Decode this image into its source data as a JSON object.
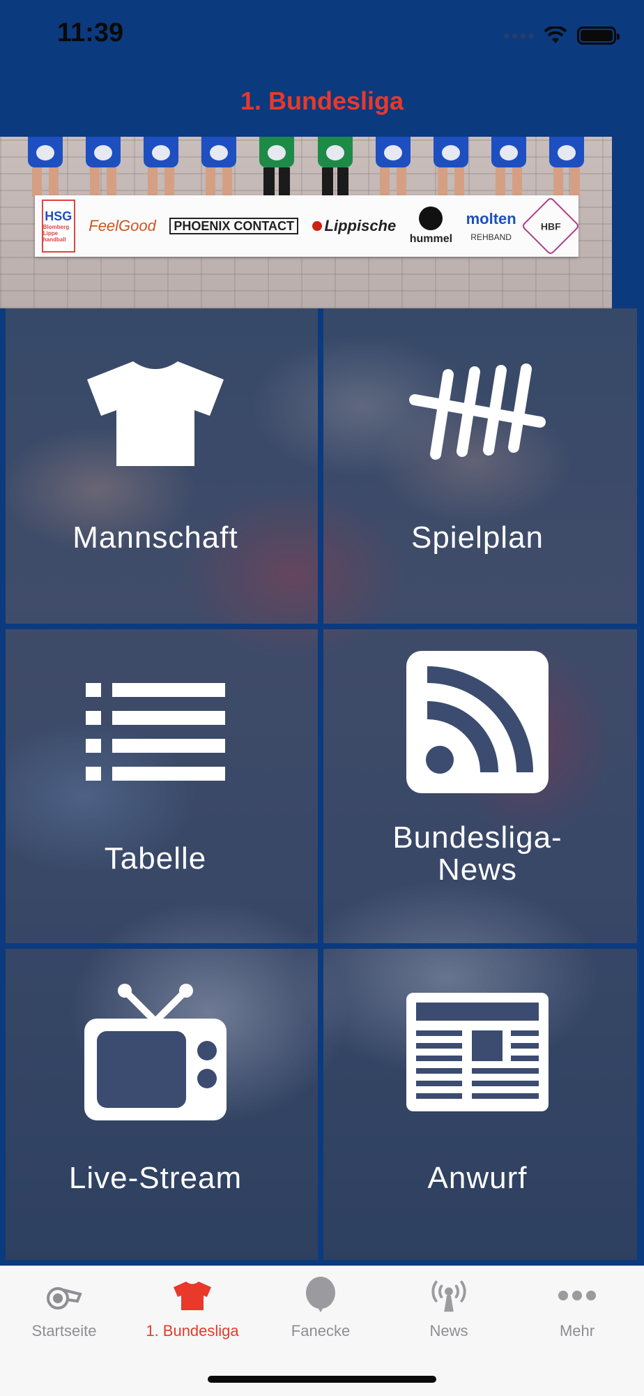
{
  "status_bar": {
    "time": "11:39"
  },
  "navbar": {
    "title": "1. Bundesliga"
  },
  "banner": {
    "sponsors": {
      "hsg": "HSG",
      "hsg_sub": "Blomberg Lippe handball",
      "feelgood": "FeelGood",
      "phoenix": "PHOENIX CONTACT",
      "lippische": "Lippische",
      "hummel": "hummel",
      "molten": "molten",
      "rehband": "REHBAND",
      "hbf": "HBF"
    }
  },
  "tiles": [
    {
      "label": "Mannschaft",
      "icon": "shirt-icon"
    },
    {
      "label": "Spielplan",
      "icon": "tally-icon"
    },
    {
      "label": "Tabelle",
      "icon": "list-icon"
    },
    {
      "label": "Bundesliga-News",
      "label_line1": "Bundesliga-",
      "label_line2": "News",
      "icon": "rss-icon"
    },
    {
      "label": "Live-Stream",
      "icon": "tv-icon"
    },
    {
      "label": "Anwurf",
      "icon": "newspaper-icon"
    }
  ],
  "tabbar": {
    "items": [
      {
        "label": "Startseite",
        "icon": "whistle-icon",
        "active": false
      },
      {
        "label": "1. Bundesliga",
        "icon": "jersey-icon",
        "active": true
      },
      {
        "label": "Fanecke",
        "icon": "balloon-icon",
        "active": false
      },
      {
        "label": "News",
        "icon": "broadcast-icon",
        "active": false
      },
      {
        "label": "Mehr",
        "icon": "more-icon",
        "active": false
      }
    ]
  },
  "colors": {
    "brand_blue": "#0b3a7e",
    "accent_red": "#e8392a",
    "inactive_gray": "#8e8e93"
  }
}
